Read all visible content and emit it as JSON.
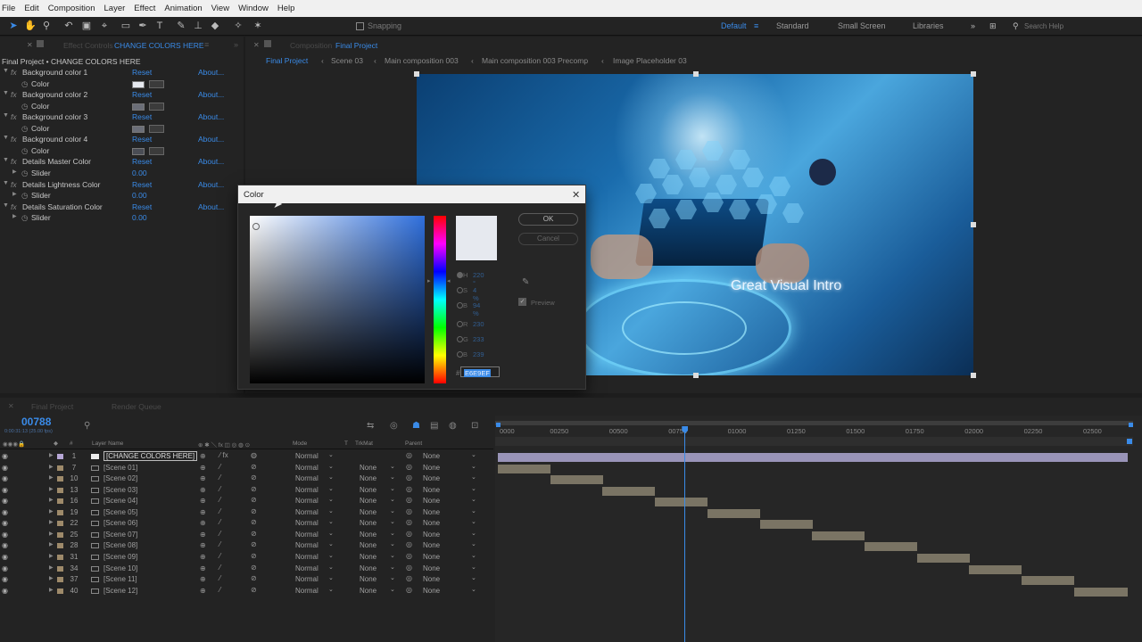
{
  "menu": [
    "File",
    "Edit",
    "Composition",
    "Layer",
    "Effect",
    "Animation",
    "View",
    "Window",
    "Help"
  ],
  "toolbar": {
    "snapping": "Snapping",
    "workspaces": [
      "Default",
      "Standard",
      "Small Screen",
      "Libraries"
    ],
    "search_placeholder": "Search Help"
  },
  "effects_panel": {
    "tab_label": "Effect Controls",
    "tab_layer": "CHANGE COLORS HERE",
    "comp_title": "Final Project • CHANGE COLORS HERE",
    "reset_label": "Reset",
    "about_label": "About...",
    "effects": [
      {
        "name": "Background color 1",
        "prop": "Color",
        "type": "color",
        "swatch": "#E6E9EF"
      },
      {
        "name": "Background color 2",
        "prop": "Color",
        "type": "color",
        "swatch": "#6b6e78"
      },
      {
        "name": "Background color 3",
        "prop": "Color",
        "type": "color",
        "swatch": "#6b6e78"
      },
      {
        "name": "Background color 4",
        "prop": "Color",
        "type": "color",
        "swatch": "#4a4d55"
      },
      {
        "name": "Details Master Color",
        "prop": "Slider",
        "type": "slider",
        "value": "0.00"
      },
      {
        "name": "Details Lightness Color",
        "prop": "Slider",
        "type": "slider",
        "value": "0.00"
      },
      {
        "name": "Details Saturation Color",
        "prop": "Slider",
        "type": "slider",
        "value": "0.00"
      }
    ]
  },
  "composition": {
    "tab_prefix": "Composition",
    "tab_name": "Final Project",
    "breadcrumbs": [
      "Final Project",
      "Scene 03",
      "Main composition 003",
      "Main composition 003 Precomp",
      "Image Placeholder 03"
    ],
    "overlay_text": "Great Visual Intro"
  },
  "color_dialog": {
    "title": "Color",
    "ok": "OK",
    "cancel": "Cancel",
    "preview": "Preview",
    "fields": [
      {
        "label": "H",
        "value": "220 °"
      },
      {
        "label": "S",
        "value": "4 %"
      },
      {
        "label": "B",
        "value": "94 %"
      },
      {
        "label": "R",
        "value": "230"
      },
      {
        "label": "G",
        "value": "233"
      },
      {
        "label": "B",
        "value": "239"
      }
    ],
    "hex": "E6E9EF",
    "current_color": "#E6E9EF"
  },
  "timeline": {
    "tabs": [
      "Final Project",
      "Render Queue"
    ],
    "timecode": "00788",
    "timecode_sub": "0:00:31:13 (25.00 fps)",
    "columns": {
      "layer_name": "Layer Name",
      "mode": "Mode",
      "t": "T",
      "trkmat": "TrkMat",
      "parent": "Parent"
    },
    "ruler": [
      "0000",
      "00250",
      "00500",
      "00750",
      "01000",
      "01250",
      "01500",
      "01750",
      "02000",
      "02250",
      "02500"
    ],
    "playhead_frame": 788,
    "layers": [
      {
        "num": "1",
        "name": "[CHANGE COLORS HERE]",
        "mode": "Normal",
        "trkmat": "",
        "parent": "None"
      },
      {
        "num": "7",
        "name": "[Scene 01]",
        "mode": "Normal",
        "trkmat": "None",
        "parent": "None"
      },
      {
        "num": "10",
        "name": "[Scene 02]",
        "mode": "Normal",
        "trkmat": "None",
        "parent": "None"
      },
      {
        "num": "13",
        "name": "[Scene 03]",
        "mode": "Normal",
        "trkmat": "None",
        "parent": "None"
      },
      {
        "num": "16",
        "name": "[Scene 04]",
        "mode": "Normal",
        "trkmat": "None",
        "parent": "None"
      },
      {
        "num": "19",
        "name": "[Scene 05]",
        "mode": "Normal",
        "trkmat": "None",
        "parent": "None"
      },
      {
        "num": "22",
        "name": "[Scene 06]",
        "mode": "Normal",
        "trkmat": "None",
        "parent": "None"
      },
      {
        "num": "25",
        "name": "[Scene 07]",
        "mode": "Normal",
        "trkmat": "None",
        "parent": "None"
      },
      {
        "num": "28",
        "name": "[Scene 08]",
        "mode": "Normal",
        "trkmat": "None",
        "parent": "None"
      },
      {
        "num": "31",
        "name": "[Scene 09]",
        "mode": "Normal",
        "trkmat": "None",
        "parent": "None"
      },
      {
        "num": "34",
        "name": "[Scene 10]",
        "mode": "Normal",
        "trkmat": "None",
        "parent": "None"
      },
      {
        "num": "37",
        "name": "[Scene 11]",
        "mode": "Normal",
        "trkmat": "None",
        "parent": "None"
      },
      {
        "num": "40",
        "name": "[Scene 12]",
        "mode": "Normal",
        "trkmat": "None",
        "parent": "None"
      }
    ]
  }
}
